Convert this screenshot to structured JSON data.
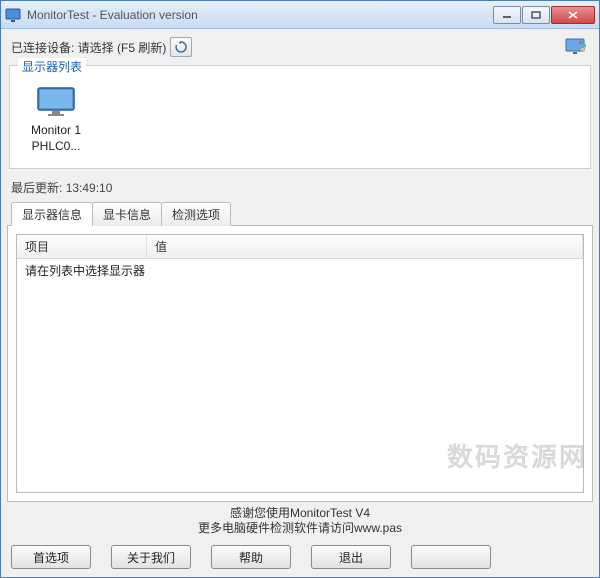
{
  "title": "MonitorTest - Evaluation version",
  "toolbar": {
    "connected_label": "已连接设备: 请选择 (F5 刷新)"
  },
  "monitors": {
    "legend": "显示器列表",
    "items": [
      {
        "name": "Monitor 1",
        "code": "PHLC0..."
      }
    ]
  },
  "last_update": {
    "label": "最后更新:",
    "time": "13:49:10"
  },
  "tabs": [
    {
      "label": "显示器信息"
    },
    {
      "label": "显卡信息"
    },
    {
      "label": "检测选项"
    }
  ],
  "table": {
    "headers": {
      "col1": "项目",
      "col2": "值"
    },
    "message": "请在列表中选择显示器"
  },
  "footer": {
    "line1": "感谢您使用MonitorTest V4",
    "line2": "更多电脑硬件检测软件请访问www.pas"
  },
  "buttons": {
    "prefs": "首选项",
    "about": "关于我们",
    "help": "帮助",
    "exit": "退出",
    "extra": ""
  },
  "watermark": "数码资源网"
}
